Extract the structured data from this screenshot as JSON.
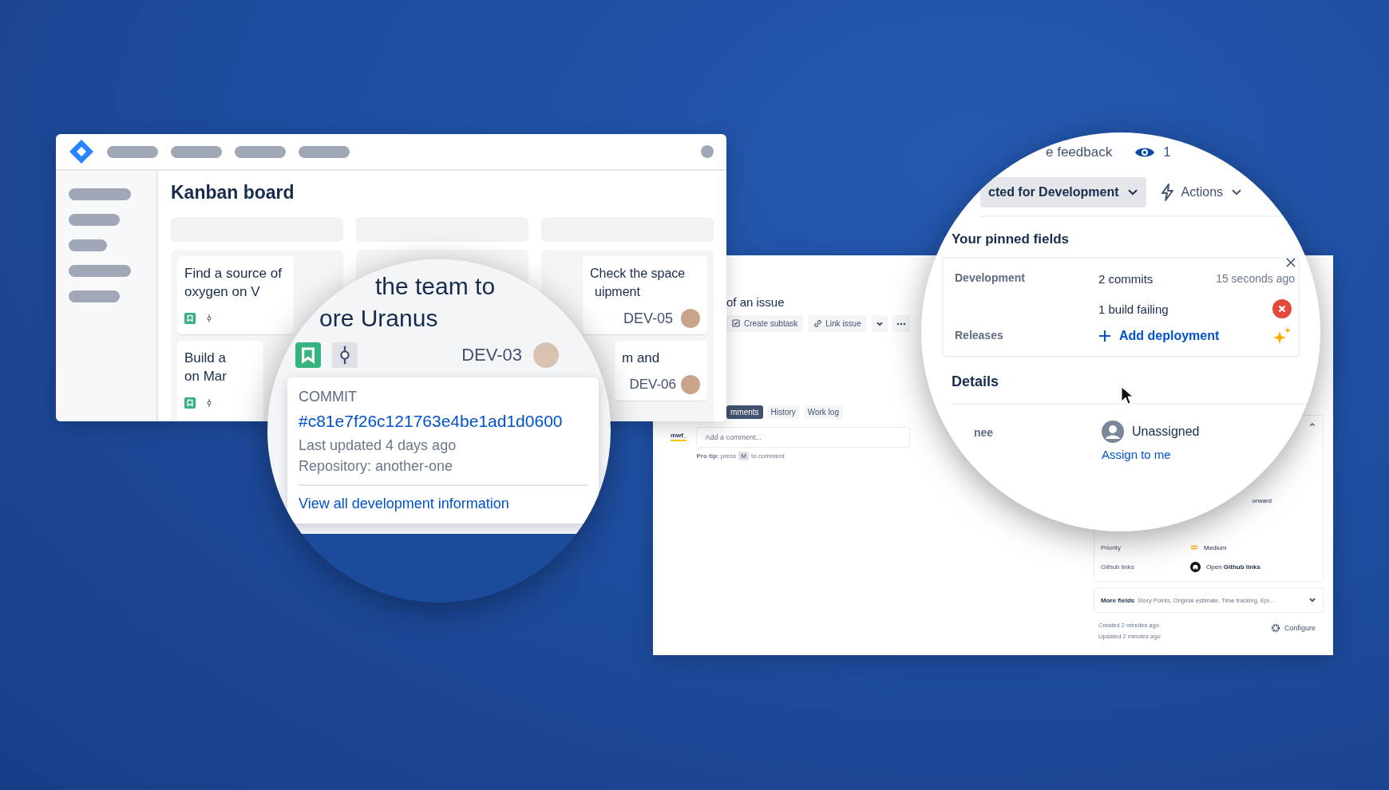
{
  "kanban_window": {
    "title": "Kanban board",
    "columns": [
      {
        "cards": [
          {
            "title_lines": [
              "Find a source of",
              "oxygen on V"
            ],
            "kind": "icons"
          },
          {
            "title_lines": [
              "Build a",
              "on Mar"
            ],
            "kind": "icons"
          }
        ]
      },
      {},
      {
        "cards": [
          {
            "title_lines": [
              "Check the space",
              "uipment"
            ],
            "kind": "assigned",
            "key": "DEV-05"
          },
          {
            "title_lines": [
              "m and"
            ],
            "kind": "assigned",
            "key": "DEV-06"
          }
        ]
      }
    ]
  },
  "zoom_board": {
    "title_lines": [
      "the team to",
      "ore Uranus"
    ],
    "key": "DEV-03",
    "popup": {
      "heading": "COMMIT",
      "hash": "#c81e7f26c121763e4be1ad1d0600",
      "updated": "Last updated 4 days ago",
      "repository": "Repository: another-one",
      "link": "View all development information"
    }
  },
  "issue_window": {
    "title": "of an issue",
    "actions": [
      {
        "label": "Create subtask",
        "kind": "subtask"
      },
      {
        "label": "Link issue",
        "kind": "link"
      }
    ],
    "tabs": [
      {
        "label": "mments",
        "selected": true
      },
      {
        "label": "History",
        "selected": false
      },
      {
        "label": "Work log",
        "selected": false
      }
    ],
    "comment": {
      "user": "mwf_",
      "placeholder": "Add a comment...",
      "tip": "**Pro tip:** press",
      "key": "M",
      "tip_end": "to comment"
    },
    "side": {
      "partial_value": "orward",
      "fields": [
        {
          "label": "Priority",
          "value": "Medium",
          "kind": "priority"
        },
        {
          "label": "Github links",
          "value": "Open **Github links**",
          "kind": "github"
        }
      ],
      "more_fields": {
        "label": "More fields",
        "summary": "Story Points, Original estimate, Time tracking, Epi..."
      },
      "created": "Created 2 minutes ago",
      "updated": "Updated 2 minutes ago",
      "configure": "Configure"
    }
  },
  "zoom_issue": {
    "feedback": "e feedback",
    "watchers": "1",
    "status": "cted for Development",
    "actions": "Actions",
    "pinned_title": "Your pinned fields",
    "pinned": [
      {
        "label": "Development",
        "values": [
          {
            "text": "2 commits",
            "meta": "15 seconds ago",
            "kind": "plain"
          },
          {
            "text": "1 build failing",
            "kind": "failing"
          }
        ]
      },
      {
        "label": "Releases",
        "values": [
          {
            "text": "Add deployment",
            "kind": "add"
          }
        ]
      }
    ],
    "details_title": "Details",
    "assignee_label": "nee",
    "assignee": "Unassigned",
    "assign_link": "Assign to me"
  }
}
